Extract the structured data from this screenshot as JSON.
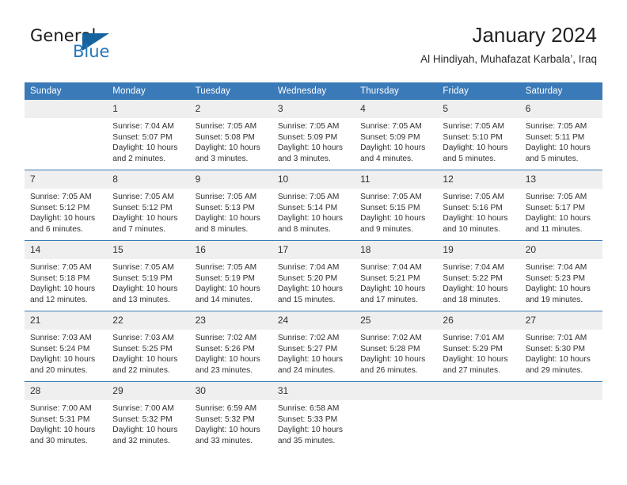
{
  "brand": {
    "word1": "General",
    "word2": "Blue",
    "triangle_color": "#14639f",
    "blue_color": "#2176bd"
  },
  "header": {
    "title": "January 2024",
    "subtitle": "Al Hindiyah, Muhafazat Karbala’, Iraq"
  },
  "theme": {
    "header_blue": "#3b7ab8",
    "daynum_gray": "#efefef",
    "text": "#303030"
  },
  "weekdays": [
    "Sunday",
    "Monday",
    "Tuesday",
    "Wednesday",
    "Thursday",
    "Friday",
    "Saturday"
  ],
  "labels": {
    "sunrise": "Sunrise:",
    "sunset": "Sunset:",
    "daylight": "Daylight:"
  },
  "weeks": [
    [
      {
        "day": "",
        "blank": true
      },
      {
        "day": "1",
        "l1": "Sunrise: 7:04 AM",
        "l2": "Sunset: 5:07 PM",
        "l3": "Daylight: 10 hours",
        "l4": "and 2 minutes."
      },
      {
        "day": "2",
        "l1": "Sunrise: 7:05 AM",
        "l2": "Sunset: 5:08 PM",
        "l3": "Daylight: 10 hours",
        "l4": "and 3 minutes."
      },
      {
        "day": "3",
        "l1": "Sunrise: 7:05 AM",
        "l2": "Sunset: 5:09 PM",
        "l3": "Daylight: 10 hours",
        "l4": "and 3 minutes."
      },
      {
        "day": "4",
        "l1": "Sunrise: 7:05 AM",
        "l2": "Sunset: 5:09 PM",
        "l3": "Daylight: 10 hours",
        "l4": "and 4 minutes."
      },
      {
        "day": "5",
        "l1": "Sunrise: 7:05 AM",
        "l2": "Sunset: 5:10 PM",
        "l3": "Daylight: 10 hours",
        "l4": "and 5 minutes."
      },
      {
        "day": "6",
        "l1": "Sunrise: 7:05 AM",
        "l2": "Sunset: 5:11 PM",
        "l3": "Daylight: 10 hours",
        "l4": "and 5 minutes."
      }
    ],
    [
      {
        "day": "7",
        "l1": "Sunrise: 7:05 AM",
        "l2": "Sunset: 5:12 PM",
        "l3": "Daylight: 10 hours",
        "l4": "and 6 minutes."
      },
      {
        "day": "8",
        "l1": "Sunrise: 7:05 AM",
        "l2": "Sunset: 5:12 PM",
        "l3": "Daylight: 10 hours",
        "l4": "and 7 minutes."
      },
      {
        "day": "9",
        "l1": "Sunrise: 7:05 AM",
        "l2": "Sunset: 5:13 PM",
        "l3": "Daylight: 10 hours",
        "l4": "and 8 minutes."
      },
      {
        "day": "10",
        "l1": "Sunrise: 7:05 AM",
        "l2": "Sunset: 5:14 PM",
        "l3": "Daylight: 10 hours",
        "l4": "and 8 minutes."
      },
      {
        "day": "11",
        "l1": "Sunrise: 7:05 AM",
        "l2": "Sunset: 5:15 PM",
        "l3": "Daylight: 10 hours",
        "l4": "and 9 minutes."
      },
      {
        "day": "12",
        "l1": "Sunrise: 7:05 AM",
        "l2": "Sunset: 5:16 PM",
        "l3": "Daylight: 10 hours",
        "l4": "and 10 minutes."
      },
      {
        "day": "13",
        "l1": "Sunrise: 7:05 AM",
        "l2": "Sunset: 5:17 PM",
        "l3": "Daylight: 10 hours",
        "l4": "and 11 minutes."
      }
    ],
    [
      {
        "day": "14",
        "l1": "Sunrise: 7:05 AM",
        "l2": "Sunset: 5:18 PM",
        "l3": "Daylight: 10 hours",
        "l4": "and 12 minutes."
      },
      {
        "day": "15",
        "l1": "Sunrise: 7:05 AM",
        "l2": "Sunset: 5:19 PM",
        "l3": "Daylight: 10 hours",
        "l4": "and 13 minutes."
      },
      {
        "day": "16",
        "l1": "Sunrise: 7:05 AM",
        "l2": "Sunset: 5:19 PM",
        "l3": "Daylight: 10 hours",
        "l4": "and 14 minutes."
      },
      {
        "day": "17",
        "l1": "Sunrise: 7:04 AM",
        "l2": "Sunset: 5:20 PM",
        "l3": "Daylight: 10 hours",
        "l4": "and 15 minutes."
      },
      {
        "day": "18",
        "l1": "Sunrise: 7:04 AM",
        "l2": "Sunset: 5:21 PM",
        "l3": "Daylight: 10 hours",
        "l4": "and 17 minutes."
      },
      {
        "day": "19",
        "l1": "Sunrise: 7:04 AM",
        "l2": "Sunset: 5:22 PM",
        "l3": "Daylight: 10 hours",
        "l4": "and 18 minutes."
      },
      {
        "day": "20",
        "l1": "Sunrise: 7:04 AM",
        "l2": "Sunset: 5:23 PM",
        "l3": "Daylight: 10 hours",
        "l4": "and 19 minutes."
      }
    ],
    [
      {
        "day": "21",
        "l1": "Sunrise: 7:03 AM",
        "l2": "Sunset: 5:24 PM",
        "l3": "Daylight: 10 hours",
        "l4": "and 20 minutes."
      },
      {
        "day": "22",
        "l1": "Sunrise: 7:03 AM",
        "l2": "Sunset: 5:25 PM",
        "l3": "Daylight: 10 hours",
        "l4": "and 22 minutes."
      },
      {
        "day": "23",
        "l1": "Sunrise: 7:02 AM",
        "l2": "Sunset: 5:26 PM",
        "l3": "Daylight: 10 hours",
        "l4": "and 23 minutes."
      },
      {
        "day": "24",
        "l1": "Sunrise: 7:02 AM",
        "l2": "Sunset: 5:27 PM",
        "l3": "Daylight: 10 hours",
        "l4": "and 24 minutes."
      },
      {
        "day": "25",
        "l1": "Sunrise: 7:02 AM",
        "l2": "Sunset: 5:28 PM",
        "l3": "Daylight: 10 hours",
        "l4": "and 26 minutes."
      },
      {
        "day": "26",
        "l1": "Sunrise: 7:01 AM",
        "l2": "Sunset: 5:29 PM",
        "l3": "Daylight: 10 hours",
        "l4": "and 27 minutes."
      },
      {
        "day": "27",
        "l1": "Sunrise: 7:01 AM",
        "l2": "Sunset: 5:30 PM",
        "l3": "Daylight: 10 hours",
        "l4": "and 29 minutes."
      }
    ],
    [
      {
        "day": "28",
        "l1": "Sunrise: 7:00 AM",
        "l2": "Sunset: 5:31 PM",
        "l3": "Daylight: 10 hours",
        "l4": "and 30 minutes."
      },
      {
        "day": "29",
        "l1": "Sunrise: 7:00 AM",
        "l2": "Sunset: 5:32 PM",
        "l3": "Daylight: 10 hours",
        "l4": "and 32 minutes."
      },
      {
        "day": "30",
        "l1": "Sunrise: 6:59 AM",
        "l2": "Sunset: 5:32 PM",
        "l3": "Daylight: 10 hours",
        "l4": "and 33 minutes."
      },
      {
        "day": "31",
        "l1": "Sunrise: 6:58 AM",
        "l2": "Sunset: 5:33 PM",
        "l3": "Daylight: 10 hours",
        "l4": "and 35 minutes."
      },
      {
        "day": "",
        "blank": true
      },
      {
        "day": "",
        "blank": true
      },
      {
        "day": "",
        "blank": true
      }
    ]
  ]
}
